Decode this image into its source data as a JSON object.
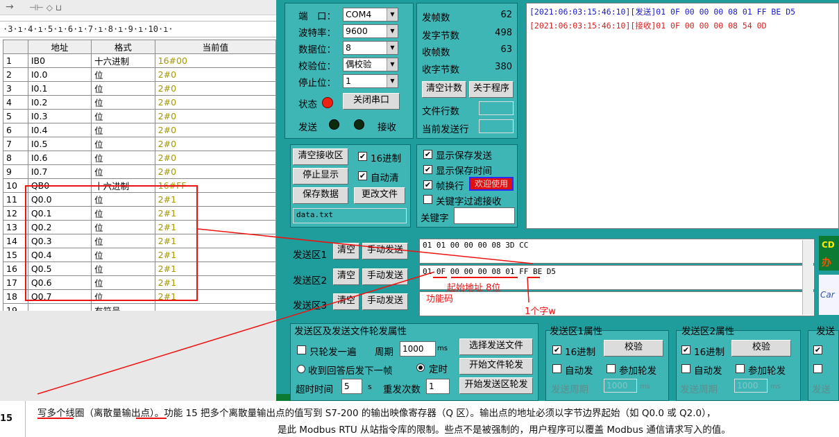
{
  "toolbar": {
    "arrow": "→",
    "glyphs": "⊣⊢ ◇ ⊔"
  },
  "ruler": "·3·ı·4·ı·5·ı·6·ı·7·ı·8·ı·9·ı·10·ı·",
  "table": {
    "headers": [
      "",
      "地址",
      "格式",
      "当前值"
    ],
    "rows": [
      [
        "1",
        "IB0",
        "十六进制",
        "16#00"
      ],
      [
        "2",
        "I0.0",
        "位",
        "2#0"
      ],
      [
        "3",
        "I0.1",
        "位",
        "2#0"
      ],
      [
        "4",
        "I0.2",
        "位",
        "2#0"
      ],
      [
        "5",
        "I0.3",
        "位",
        "2#0"
      ],
      [
        "6",
        "I0.4",
        "位",
        "2#0"
      ],
      [
        "7",
        "I0.5",
        "位",
        "2#0"
      ],
      [
        "8",
        "I0.6",
        "位",
        "2#0"
      ],
      [
        "9",
        "I0.7",
        "位",
        "2#0"
      ],
      [
        "10",
        "QB0",
        "十六进制",
        "16#FF"
      ],
      [
        "11",
        "Q0.0",
        "位",
        "2#1"
      ],
      [
        "12",
        "Q0.1",
        "位",
        "2#1"
      ],
      [
        "13",
        "Q0.2",
        "位",
        "2#1"
      ],
      [
        "14",
        "Q0.3",
        "位",
        "2#1"
      ],
      [
        "15",
        "Q0.4",
        "位",
        "2#1"
      ],
      [
        "16",
        "Q0.5",
        "位",
        "2#1"
      ],
      [
        "17",
        "Q0.6",
        "位",
        "2#1"
      ],
      [
        "18",
        "Q0.7",
        "位",
        "2#1"
      ],
      [
        "19",
        "",
        "有符号",
        ""
      ]
    ]
  },
  "serial": {
    "port_label": "端　口：",
    "port_value": "COM4",
    "baud_label": "波特率：",
    "baud_value": "9600",
    "data_label": "数据位：",
    "data_value": "8",
    "parity_label": "校验位：",
    "parity_value": "偶校验",
    "stop_label": "停止位：",
    "stop_value": "1",
    "status_label": "状态",
    "close_port": "关闭串口",
    "send_label": "发送",
    "recv_label": "接收"
  },
  "stats": {
    "sent_frames_label": "发帧数",
    "sent_frames": "62",
    "sent_bytes_label": "发字节数",
    "sent_bytes": "498",
    "recv_frames_label": "收帧数",
    "recv_frames": "63",
    "recv_bytes_label": "收字节数",
    "recv_bytes": "380",
    "clear_count": "清空计数",
    "about": "关于程序",
    "file_lines_label": "文件行数",
    "current_line_label": "当前发送行"
  },
  "log": {
    "line1_time": "[2021:06:03:15:46:10]",
    "line1_tag": "[发送]",
    "line1_data": "01 0F 00 00 00 08 01 FF BE D5",
    "line2_time": "[2021:06:03:15:46:10]",
    "line2_tag": "[接收]",
    "line2_data": "01 0F 00 00 00 08 54 0D"
  },
  "recv_controls": {
    "clear_recv": "清空接收区",
    "hex16": "16进制",
    "stop_display": "停止显示",
    "auto_clear": "自动清",
    "save_data": "保存数据",
    "change_file": "更改文件",
    "filename": "data.txt"
  },
  "options": {
    "show_save_send": "显示保存发送",
    "show_save_time": "显示保存时间",
    "frame_newline": "帧换行",
    "badge": "欢迎使用",
    "keyword_filter": "关键字过滤接收",
    "keyword_label": "关键字"
  },
  "send": {
    "area1_label": "发送区1",
    "area2_label": "发送区2",
    "area3_label": "发送区3",
    "clear": "清空",
    "manual_send": "手动发送",
    "area1_data": "01 01 00 00 00 08 3D CC",
    "area2_data": "01 0F 00 00 00 08 01 FF BE D5",
    "area3_data": ""
  },
  "props": {
    "title": "发送区及发送文件轮发属性",
    "single_round": "只轮发一遍",
    "period_label": "周期",
    "period_value": "1000",
    "ms": "ms",
    "choose_file": "选择发送文件",
    "after_reply": "收到回答后发下一帧",
    "timed": "定时",
    "start_file_round": "开始文件轮发",
    "timeout_label": "超时时间",
    "timeout_value": "5",
    "s": "s",
    "retry_label": "重发次数",
    "retry_value": "1",
    "start_area_round": "开始发送区轮发"
  },
  "area1_props": {
    "title": "发送区1属性",
    "hex": "16进制",
    "verify": "校验",
    "auto_send": "自动发",
    "join_round": "参加轮发",
    "period": "发送周期",
    "period_value": "1000",
    "ms": "ms"
  },
  "area2_props": {
    "title": "发送区2属性",
    "hex": "16进制",
    "verify": "校验",
    "auto_send": "自动发",
    "join_round": "参加轮发",
    "period": "发送周期",
    "period_value": "1000",
    "ms": "ms"
  },
  "area3_props": {
    "title": "发送",
    "period": "发送"
  },
  "side_tag": {
    "top": "CD",
    "mid": "办",
    "bot": "Car"
  },
  "annotations": {
    "start_addr": "起始地址 8位",
    "func_code": "功能码",
    "one_word": "1个字w"
  },
  "caption": {
    "num": "15",
    "line1_a": "写多个线圈（离散量输出点）",
    "line1_b": "。功能 15 把多个离散量输出点的值写到 S7-200 的输出映像寄存器（Q 区）。输出点的地址必须以字节边界起始（如 Q0.0 或 Q2.0），",
    "line2": "是此 Modbus RTU 从站指令库的限制。些点不是被强制的，用户程序可以覆盖 Modbus 通信请求写入的值。"
  }
}
